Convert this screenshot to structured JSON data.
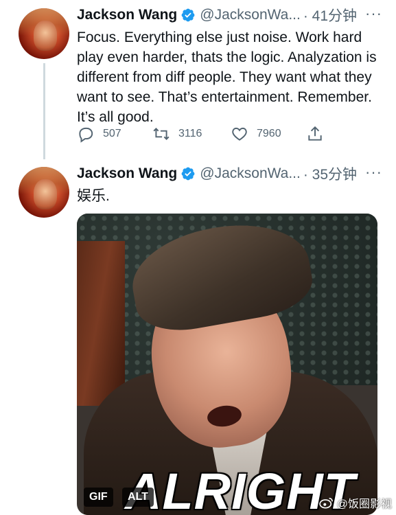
{
  "tweet1": {
    "name": "Jackson Wang",
    "handle": "@JacksonWa...",
    "time": "· 41分钟",
    "more": "···",
    "text": "Focus. Everything else just noise. Work hard play even harder, thats the logic. Analyzation is different from diff people. They want what they want to see. That’s entertainment. Remember. It’s all good.",
    "replies": "507",
    "retweets": "3116",
    "likes": "7960"
  },
  "tweet2": {
    "name": "Jackson Wang",
    "handle": "@JacksonWa...",
    "time": "· 35分钟",
    "more": "···",
    "text": "娱乐.",
    "media": {
      "caption": "ALRIGHT",
      "gif_badge": "GIF",
      "alt_badge": "ALT"
    }
  },
  "watermark": "@饭圈影视",
  "colors": {
    "verified": "#1d9bf0",
    "secondary_text": "#536471",
    "thread_line": "#cfd9de"
  },
  "icons": [
    "reply-icon",
    "retweet-icon",
    "like-icon",
    "share-icon",
    "verified-badge-icon",
    "weibo-icon"
  ]
}
